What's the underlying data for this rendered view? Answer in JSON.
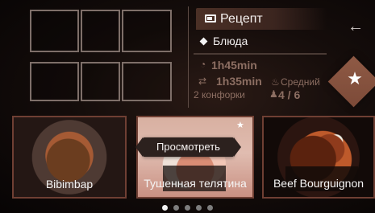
{
  "header": {
    "recipe_tab": "Рецепт",
    "dishes_label": "Блюда"
  },
  "stats": {
    "time_one": "1h45min",
    "time_two": "1h35min",
    "difficulty": "Средний",
    "burners": "2 конфорки",
    "servings": "4 / 6"
  },
  "actions": {
    "view_label": "Просмотреть"
  },
  "cards": [
    {
      "title": "Bibimbap"
    },
    {
      "title": "Тушенная телятина"
    },
    {
      "title": "Beef Bourguignon"
    }
  ],
  "icons": {
    "recipe_tab_icon": "recipe-icon",
    "dish_marker_icon": "diamond-icon",
    "back_icon": "back-arrow-icon",
    "timer_icon": "timer-icon",
    "pan_icon": "pan-icon",
    "difficulty_icon": "chef-hat-icon",
    "servings_icon": "people-icon",
    "favorite_icon": "star-icon",
    "card_favorite_icon": "star-icon"
  },
  "colors": {
    "accent": "#8f5a45",
    "muted_text": "#8c6e62"
  },
  "pagination": {
    "active_index": 1,
    "count": 5
  }
}
